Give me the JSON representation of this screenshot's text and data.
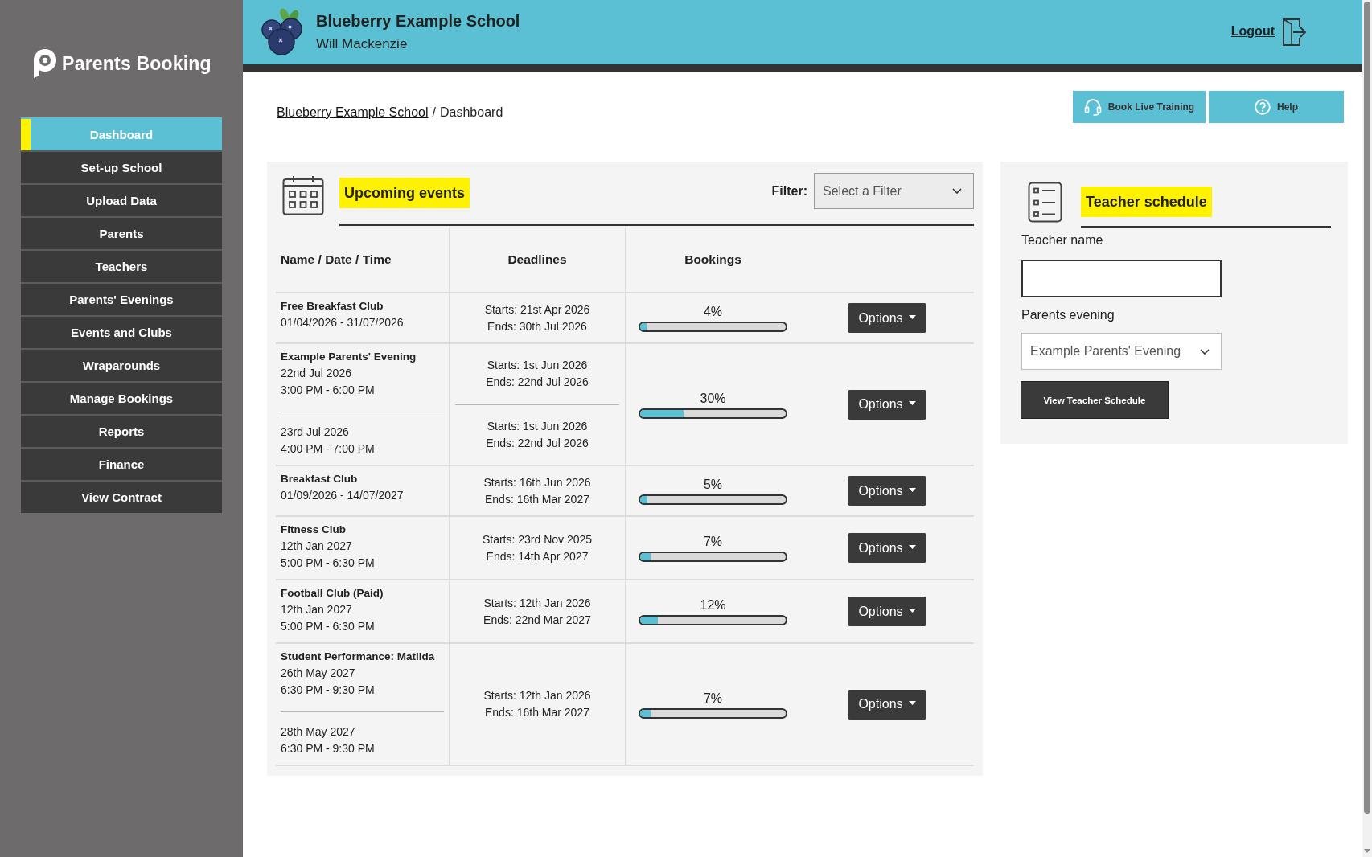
{
  "sidebar": {
    "brand": "Parents Booking",
    "items": [
      {
        "label": "Dashboard",
        "selected": true
      },
      {
        "label": "Set-up School",
        "selected": false
      },
      {
        "label": "Upload Data",
        "selected": false
      },
      {
        "label": "Parents",
        "selected": false
      },
      {
        "label": "Teachers",
        "selected": false
      },
      {
        "label": "Parents' Evenings",
        "selected": false
      },
      {
        "label": "Events and Clubs",
        "selected": false
      },
      {
        "label": "Wraparounds",
        "selected": false
      },
      {
        "label": "Manage Bookings",
        "selected": false
      },
      {
        "label": "Reports",
        "selected": false
      },
      {
        "label": "Finance",
        "selected": false
      },
      {
        "label": "View Contract",
        "selected": false
      }
    ]
  },
  "header": {
    "school": "Blueberry Example School",
    "user": "Will Mackenzie",
    "logout": "Logout"
  },
  "breadcrumb": {
    "separator": "/",
    "items": [
      {
        "label": "Blueberry Example School",
        "kind": "link"
      },
      {
        "label": "Dashboard",
        "kind": "current"
      }
    ]
  },
  "actions": [
    {
      "label": "Book Live Training",
      "kind": "training"
    },
    {
      "label": "Help",
      "kind": "help"
    }
  ],
  "events": {
    "title": "Upcoming events",
    "filter": {
      "label": "Filter:",
      "placeholder": "Select a Filter"
    },
    "columns": [
      "Name / Date / Time",
      "Deadlines",
      "Bookings"
    ],
    "rows": [
      {
        "name": "Free Breakfast Club",
        "sessions": [
          [
            "01/04/2026 - 31/07/2026"
          ]
        ],
        "deadlines": [
          [
            "Starts: 21st Apr 2026",
            "Ends: 30th Jul 2026"
          ]
        ],
        "percent": "4%",
        "level": 0.04,
        "action": "Options"
      },
      {
        "name": "Example Parents' Evening",
        "sessions": [
          [
            "22nd Jul 2026",
            "3:00 PM - 6:00 PM"
          ],
          [
            "23rd Jul 2026",
            "4:00 PM - 7:00 PM"
          ]
        ],
        "deadlines": [
          [
            "Starts: 1st Jun 2026",
            "Ends: 22nd Jul 2026"
          ],
          [
            "Starts: 1st Jun 2026",
            "Ends: 22nd Jul 2026"
          ]
        ],
        "percent": "30%",
        "level": 0.3,
        "action": "Options"
      },
      {
        "name": "Breakfast Club",
        "sessions": [
          [
            "01/09/2026 - 14/07/2027"
          ]
        ],
        "deadlines": [
          [
            "Starts: 16th Jun 2026",
            "Ends: 16th Mar 2027"
          ]
        ],
        "percent": "5%",
        "level": 0.05,
        "action": "Options"
      },
      {
        "name": "Fitness Club",
        "sessions": [
          [
            "12th Jan 2027",
            "5:00 PM - 6:30 PM"
          ]
        ],
        "deadlines": [
          [
            "Starts: 23rd Nov 2025",
            "Ends: 14th Apr 2027"
          ]
        ],
        "percent": "7%",
        "level": 0.07,
        "action": "Options"
      },
      {
        "name": "Football Club (Paid)",
        "sessions": [
          [
            "12th Jan 2027",
            "5:00 PM - 6:30 PM"
          ]
        ],
        "deadlines": [
          [
            "Starts: 12th Jan 2026",
            "Ends: 22nd Mar 2027"
          ]
        ],
        "percent": "12%",
        "level": 0.12,
        "action": "Options"
      },
      {
        "name": "Student Performance: Matilda",
        "sessions": [
          [
            "26th May 2027",
            "6:30 PM - 9:30 PM"
          ],
          [
            "28th May 2027",
            "6:30 PM - 9:30 PM"
          ]
        ],
        "deadlines": [
          [
            "Starts: 12th Jan 2026",
            "Ends: 16th Mar 2027"
          ]
        ],
        "percent": "7%",
        "level": 0.07,
        "action": "Options"
      }
    ]
  },
  "teacher_schedule": {
    "title": "Teacher schedule",
    "fields": [
      {
        "label": "Teacher name",
        "kind": "text"
      },
      {
        "label": "Parents evening",
        "kind": "select",
        "value": "Example Parents' Evening"
      }
    ],
    "button": "View Teacher Schedule"
  }
}
